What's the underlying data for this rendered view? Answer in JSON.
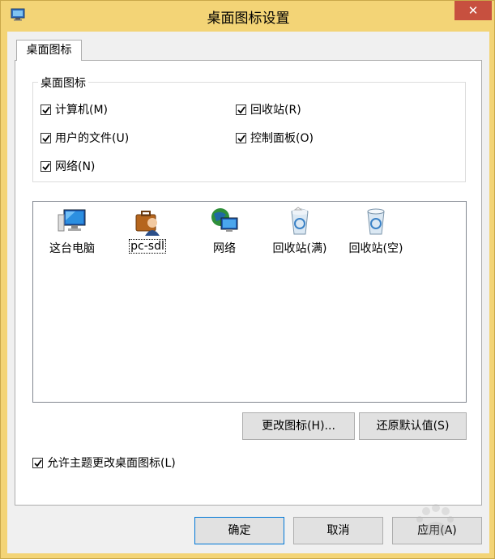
{
  "window": {
    "title": "桌面图标设置",
    "close_glyph": "✕"
  },
  "tabs": [
    {
      "label": "桌面图标",
      "selected": true
    }
  ],
  "group": {
    "legend": "桌面图标",
    "checkboxes": [
      {
        "label": "计算机(M)",
        "checked": true
      },
      {
        "label": "回收站(R)",
        "checked": true
      },
      {
        "label": "用户的文件(U)",
        "checked": true
      },
      {
        "label": "控制面板(O)",
        "checked": true
      },
      {
        "label": "网络(N)",
        "checked": true
      }
    ]
  },
  "icon_list": {
    "items": [
      {
        "label": "这台电脑",
        "icon": "computer-icon",
        "selected": false
      },
      {
        "label": "pc-sdl",
        "icon": "user-folder-icon",
        "selected": true
      },
      {
        "label": "网络",
        "icon": "network-icon",
        "selected": false
      },
      {
        "label": "回收站(满)",
        "icon": "recycle-bin-full-icon",
        "selected": false
      },
      {
        "label": "回收站(空)",
        "icon": "recycle-bin-empty-icon",
        "selected": false
      }
    ]
  },
  "buttons": {
    "change_icon": "更改图标(H)...",
    "restore_default": "还原默认值(S)",
    "ok": "确定",
    "cancel": "取消",
    "apply": "应用(A)"
  },
  "allow_themes": {
    "label": "允许主题更改桌面图标(L)",
    "checked": true
  },
  "colors": {
    "title_bar": "#f3d476",
    "close_button": "#c7503f",
    "selection_outline": "#0078d7"
  }
}
